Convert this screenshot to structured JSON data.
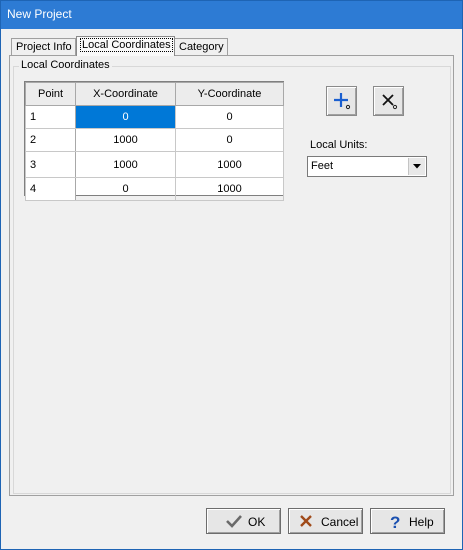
{
  "window": {
    "title": "New Project"
  },
  "tabs": [
    {
      "label": "Project Info"
    },
    {
      "label": "Local Coordinates"
    },
    {
      "label": "Category"
    }
  ],
  "group": {
    "label": "Local Coordinates"
  },
  "grid": {
    "headers": [
      "Point",
      "X-Coordinate",
      "Y-Coordinate"
    ],
    "rows": [
      {
        "point": "1",
        "x": "0",
        "y": "0"
      },
      {
        "point": "2",
        "x": "1000",
        "y": "0"
      },
      {
        "point": "3",
        "x": "1000",
        "y": "1000"
      },
      {
        "point": "4",
        "x": "0",
        "y": "1000"
      }
    ]
  },
  "units": {
    "label": "Local Units:",
    "value": "Feet"
  },
  "buttons": {
    "ok": "OK",
    "cancel": "Cancel",
    "help": "Help"
  },
  "colors": {
    "titlebar": "#2d7bd4",
    "selection": "#0078d7"
  }
}
